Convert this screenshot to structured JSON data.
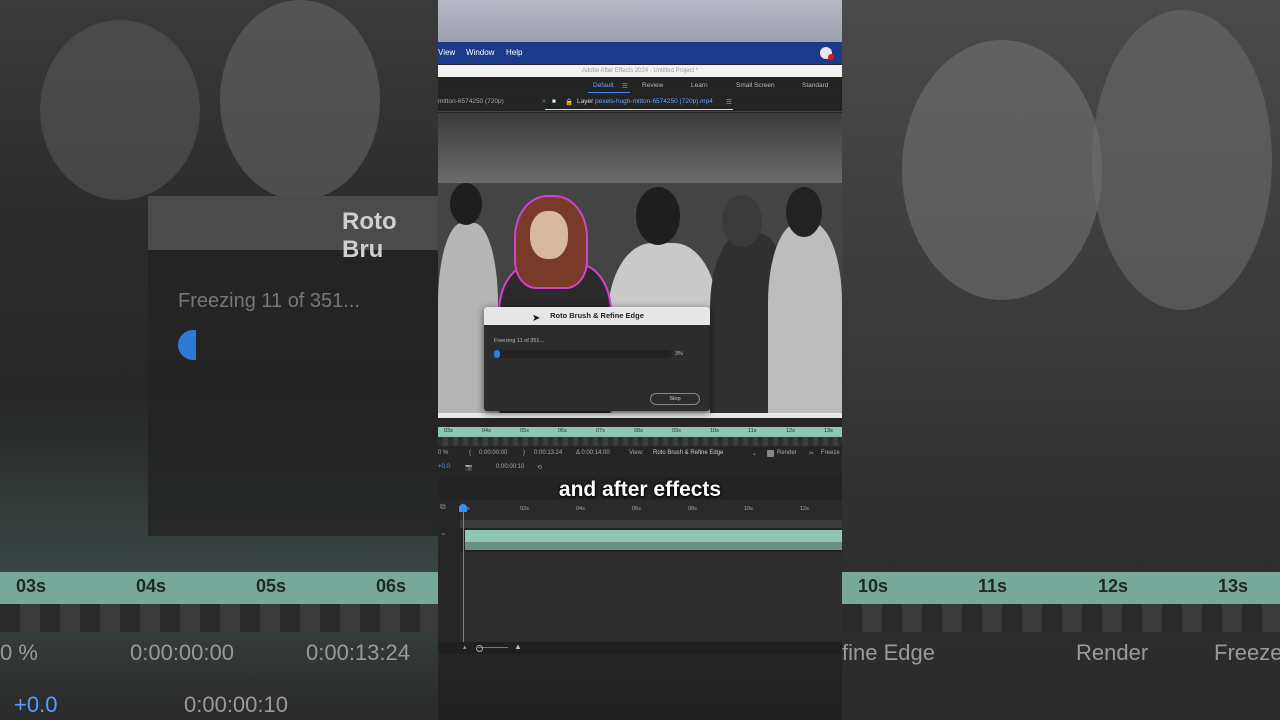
{
  "menu": {
    "view": "View",
    "window": "Window",
    "help": "Help"
  },
  "title": "Adobe After Effects 2024 - Untitled Project *",
  "workspaces": {
    "default": "Default",
    "review": "Review",
    "learn": "Learn",
    "small_screen": "Small Screen",
    "standard": "Standard"
  },
  "panel": {
    "comp_tab": "mitton-6574250 (720p)",
    "layer_prefix": "Layer",
    "layer_name": "pexels-hugh-mitton-6574250 (720p).mp4"
  },
  "dialog": {
    "title": "Roto Brush & Refine Edge",
    "message": "Freezing 11 of 351...",
    "progress_percent": 3,
    "progress_label": "3%",
    "stop": "Stop"
  },
  "ruler_ticks": [
    "03s",
    "04s",
    "05s",
    "06s",
    "07s",
    "08s",
    "09s",
    "10s",
    "11s",
    "12s",
    "13s"
  ],
  "controls": {
    "zoom": "0 %",
    "in_time": "0:00:00:00",
    "out_time": "0:00:13:24",
    "duration": "Δ 0:00:14:00",
    "view_label": "View:",
    "view_value": "Roto Brush & Refine Edge",
    "render": "Render",
    "freeze": "Freeze",
    "exposure": "+0.0",
    "current_time": "0:00:00:10"
  },
  "timeline_ticks": [
    "0s",
    "02s",
    "04s",
    "06s",
    "08s",
    "10s",
    "12s"
  ],
  "caption": "and after effects",
  "background": {
    "dialog_title": "Roto Bru",
    "freezing": "Freezing 11 of 351...",
    "ruler": [
      "03s",
      "04s",
      "05s",
      "06s"
    ],
    "ruler_right": [
      "10s",
      "11s",
      "12s",
      "13s"
    ],
    "zoom": "0 %",
    "in_time": "0:00:00:00",
    "out_time": "0:00:13:24",
    "exposure": "+0.0",
    "current_time": "0:00:00:10",
    "right_view": "fine Edge",
    "right_render": "Render",
    "right_freeze": "Freeze"
  },
  "colors": {
    "accent": "#2f7ee0",
    "roto_outline": "#d045c8",
    "ruler": "#8fc6b3",
    "menubar": "#1b3a8a"
  }
}
